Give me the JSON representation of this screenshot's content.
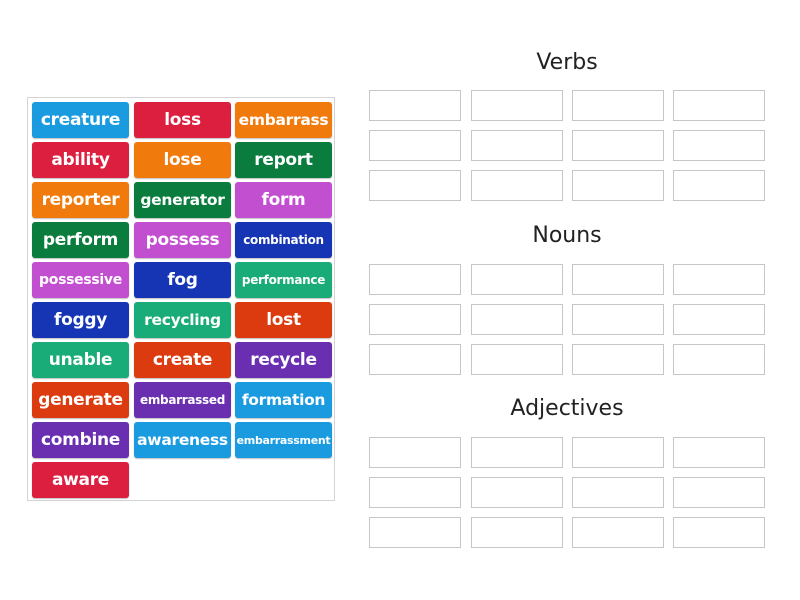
{
  "tile_bank": {
    "tiles": [
      {
        "label": "creature",
        "color": "#1a9be0"
      },
      {
        "label": "loss",
        "color": "#dc1f3f"
      },
      {
        "label": "embarrass",
        "color": "#f07b0c"
      },
      {
        "label": "ability",
        "color": "#dc1f3f"
      },
      {
        "label": "lose",
        "color": "#f07b0c"
      },
      {
        "label": "report",
        "color": "#0a7d3e"
      },
      {
        "label": "reporter",
        "color": "#f07b0c"
      },
      {
        "label": "generator",
        "color": "#0a7d3e"
      },
      {
        "label": "form",
        "color": "#c24fd0"
      },
      {
        "label": "perform",
        "color": "#0a7d3e"
      },
      {
        "label": "possess",
        "color": "#c24fd0"
      },
      {
        "label": "combination",
        "color": "#1535b5"
      },
      {
        "label": "possessive",
        "color": "#c24fd0"
      },
      {
        "label": "fog",
        "color": "#1535b5"
      },
      {
        "label": "performance",
        "color": "#1aac78"
      },
      {
        "label": "foggy",
        "color": "#1535b5"
      },
      {
        "label": "recycling",
        "color": "#1aac78"
      },
      {
        "label": "lost",
        "color": "#dc3b0f"
      },
      {
        "label": "unable",
        "color": "#1aac78"
      },
      {
        "label": "create",
        "color": "#dc3b0f"
      },
      {
        "label": "recycle",
        "color": "#6a2fb0"
      },
      {
        "label": "generate",
        "color": "#dc3b0f"
      },
      {
        "label": "embarrassed",
        "color": "#6a2fb0"
      },
      {
        "label": "formation",
        "color": "#1a9be0"
      },
      {
        "label": "combine",
        "color": "#6a2fb0"
      },
      {
        "label": "awareness",
        "color": "#1a9be0"
      },
      {
        "label": "embarrassment",
        "color": "#1a9be0"
      },
      {
        "label": "aware",
        "color": "#dc1f3f"
      }
    ]
  },
  "groups": [
    {
      "title": "Verbs",
      "slot_count": 12
    },
    {
      "title": "Nouns",
      "slot_count": 12
    },
    {
      "title": "Adjectives",
      "slot_count": 12
    }
  ]
}
